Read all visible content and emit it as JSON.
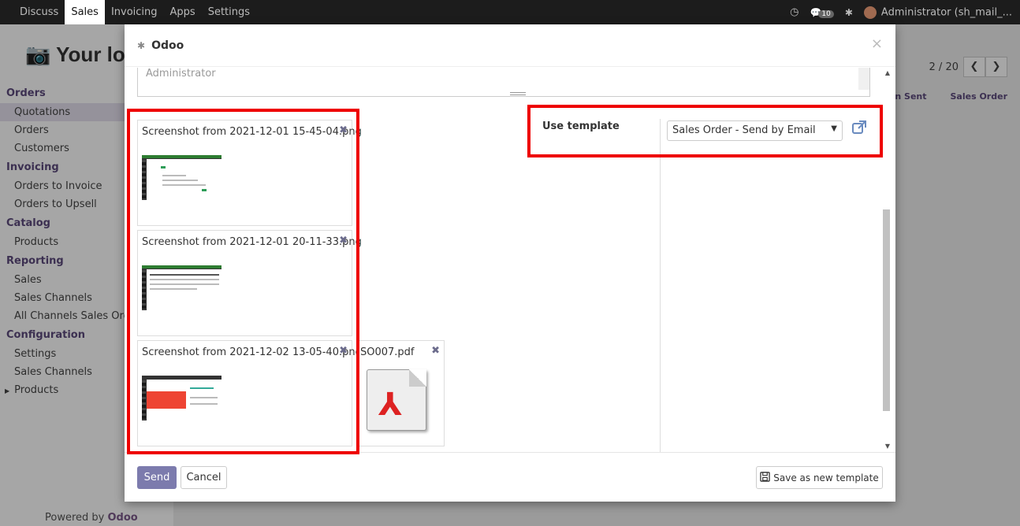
{
  "navbar": {
    "items": [
      {
        "label": "Discuss",
        "active": false
      },
      {
        "label": "Sales",
        "active": true
      },
      {
        "label": "Invoicing",
        "active": false
      },
      {
        "label": "Apps",
        "active": false
      },
      {
        "label": "Settings",
        "active": false
      }
    ],
    "message_count": "10",
    "user": "Administrator (sh_mail_..."
  },
  "sidebar": {
    "logo": "Your log",
    "sections": [
      {
        "title": "Orders",
        "items": [
          "Quotations",
          "Orders",
          "Customers"
        ]
      },
      {
        "title": "Invoicing",
        "items": [
          "Orders to Invoice",
          "Orders to Upsell"
        ]
      },
      {
        "title": "Catalog",
        "items": [
          "Products"
        ]
      },
      {
        "title": "Reporting",
        "items": [
          "Sales",
          "Sales Channels",
          "All Channels Sales Orde"
        ]
      },
      {
        "title": "Configuration",
        "items": [
          "Settings",
          "Sales Channels",
          "Products"
        ]
      }
    ],
    "powered_by": "Powered by",
    "powered_brand": "Odoo"
  },
  "background": {
    "pager": "2 / 20",
    "status_1": "n Sent",
    "status_2": "Sales Order"
  },
  "modal": {
    "title": "Odoo",
    "close": "×",
    "body_text": "Administrator",
    "attachments": [
      {
        "name": "Screenshot from 2021-12-01 15-45-04.png",
        "delete": "✖"
      },
      {
        "name": "Screenshot from 2021-12-01 20-11-33.png",
        "delete": "✖"
      },
      {
        "name": "Screenshot from 2021-12-02 13-05-40.png",
        "delete": "✖"
      }
    ],
    "pdf_attachment": {
      "name": "SO007.pdf",
      "delete": "✖"
    },
    "template": {
      "label": "Use template",
      "selected": "Sales Order - Send by Email"
    },
    "footer": {
      "send": "Send",
      "cancel": "Cancel",
      "save_template": "Save as new template"
    }
  },
  "colors": {
    "accent": "#7c7bad",
    "highlight": "#e00000",
    "brand": "#5c4a7d"
  }
}
